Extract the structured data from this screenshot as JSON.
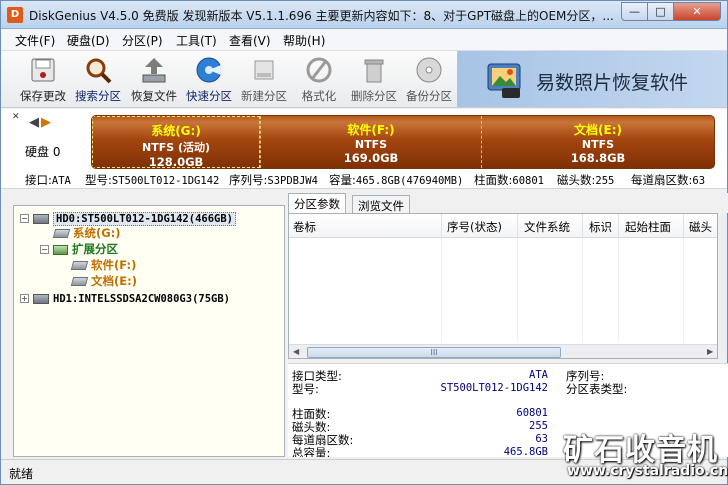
{
  "window": {
    "title": "DiskGenius V4.5.0 免费版   发现新版本 V5.1.1.696 主要更新内容如下：8、对于GPT磁盘上的OEM分区，...",
    "app_icon": "D",
    "minimize": "—",
    "maximize": "□",
    "close": "✕"
  },
  "menu": [
    "文件(F)",
    "硬盘(D)",
    "分区(P)",
    "工具(T)",
    "查看(V)",
    "帮助(H)"
  ],
  "toolbar": {
    "buttons": [
      {
        "label": "保存更改",
        "icon": "save-icon"
      },
      {
        "label": "搜索分区",
        "icon": "search-partition-icon"
      },
      {
        "label": "恢复文件",
        "icon": "recover-file-icon"
      },
      {
        "label": "快速分区",
        "icon": "quick-partition-icon"
      },
      {
        "label": "新建分区",
        "icon": "new-partition-icon"
      },
      {
        "label": "格式化",
        "icon": "format-icon"
      },
      {
        "label": "删除分区",
        "icon": "delete-partition-icon"
      },
      {
        "label": "备份分区",
        "icon": "backup-partition-icon"
      }
    ],
    "ad_text": "易数照片恢复软件"
  },
  "disk_map": {
    "disk_label": "硬盘 0",
    "nav_prev": "◀",
    "nav_next": "▶",
    "pin": "✕",
    "partitions": [
      {
        "name": "系统(G:)",
        "fs": "NTFS (活动)",
        "size": "128.0GB"
      },
      {
        "name": "软件(F:)",
        "fs": "NTFS",
        "size": "169.0GB"
      },
      {
        "name": "文档(E:)",
        "fs": "NTFS",
        "size": "168.8GB"
      }
    ]
  },
  "disk_info": {
    "interface_label": "接口:",
    "interface": "ATA",
    "model_label": "型号:",
    "model": "ST500LT012-1DG142",
    "serial_label": "序列号:",
    "serial": "S3PDBJW4",
    "capacity_label": "容量:",
    "capacity": "465.8GB(476940MB)",
    "cylinders_label": "柱面数:",
    "cylinders": "60801",
    "heads_label": "磁头数:",
    "heads": "255",
    "sectors_label": "每道扇区数:",
    "sectors": "63"
  },
  "tree": {
    "hd0": "HD0:ST500LT012-1DG142(466GB)",
    "sys": "系统(G:)",
    "ext": "扩展分区",
    "soft": "软件(F:)",
    "doc": "文档(E:)",
    "hd1": "HD1:INTELSSDSA2CW080G3(75GB)",
    "collapse": "−",
    "expand": "+"
  },
  "tabs": [
    "分区参数",
    "浏览文件"
  ],
  "columns": [
    "卷标",
    "序号(状态)",
    "文件系统",
    "标识",
    "起始柱面",
    "磁头"
  ],
  "scroll": {
    "thumb": "III",
    "left": "◀",
    "right": "▶"
  },
  "details": {
    "interface_type_label": "接口类型:",
    "interface_type": "ATA",
    "model_label": "型号:",
    "model": "ST500LT012-1DG142",
    "serial_label": "序列号:",
    "pt_type_label": "分区表类型:",
    "cylinders_label": "柱面数:",
    "cylinders": "60801",
    "heads_label": "磁头数:",
    "heads": "255",
    "sectors_label": "每道扇区数:",
    "sectors": "63",
    "capacity_label": "总容量:",
    "capacity": "465.8GB"
  },
  "status": "就绪",
  "watermark": {
    "line1": "矿石收音机",
    "line2": "www.crystalradio.cn"
  }
}
